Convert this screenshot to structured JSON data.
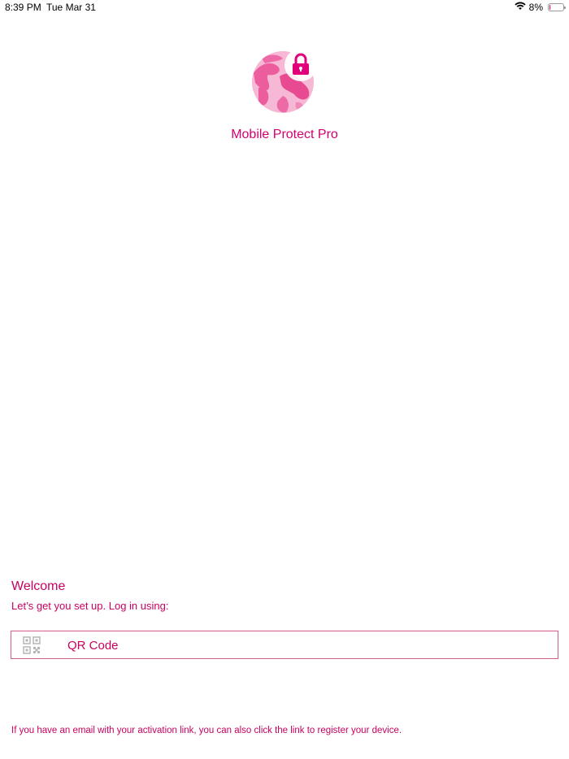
{
  "status_bar": {
    "time": "8:39 PM",
    "date": "Tue Mar 31",
    "battery_percent": "8%",
    "battery_level": 0.08,
    "wifi_icon": "wifi-icon",
    "battery_icon": "battery-icon"
  },
  "app": {
    "name": "Mobile Protect Pro",
    "logo_icon": "globe-lock-icon",
    "brand_color": "#d4006f"
  },
  "welcome": {
    "title": "Welcome",
    "subtitle": "Let’s get you set up. Log in using:"
  },
  "login_options": {
    "qr": {
      "label": "QR Code",
      "icon": "qr-code-icon"
    }
  },
  "footer": {
    "note": "If you have an email with your activation link, you can also click the link to register your device."
  }
}
